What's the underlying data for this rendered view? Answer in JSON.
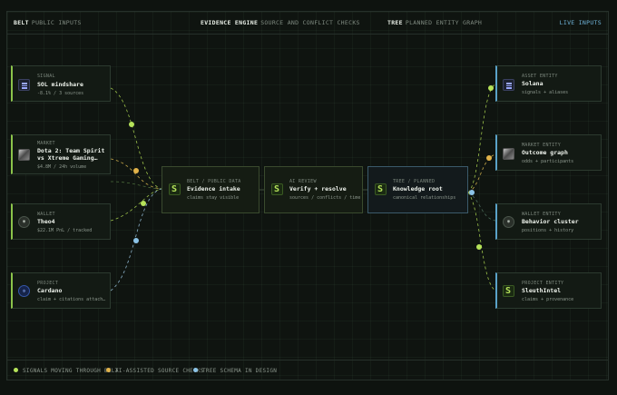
{
  "header": {
    "belt_label": "BELT",
    "belt_sub": "PUBLIC INPUTS",
    "engine_label": "EVIDENCE ENGINE",
    "engine_sub": "SOURCE AND CONFLICT CHECKS",
    "tree_label": "TREE",
    "tree_sub": "PLANNED ENTITY GRAPH",
    "live_label": "LIVE INPUTS"
  },
  "inputs": [
    {
      "kicker": "SIGNAL",
      "title": "SOL mindshare",
      "sub": "-8.1% / 3 sources",
      "icon": "solana-icon"
    },
    {
      "kicker": "MARKET",
      "title": "Dota 2: Team Spirit",
      "title2": "vs Xtreme Gaming…",
      "sub": "$4.8M / 24h volume",
      "icon": "market-image-icon"
    },
    {
      "kicker": "WALLET",
      "title": "Theo4",
      "sub": "$22.1M PnL / tracked",
      "icon": "wallet-avatar-icon"
    },
    {
      "kicker": "PROJECT",
      "title": "Cardano",
      "sub": "claim + citations attach…",
      "icon": "cardano-icon"
    }
  ],
  "stages": [
    {
      "kicker": "BELT / PUBLIC DATA",
      "title": "Evidence intake",
      "sub": "claims stay visible"
    },
    {
      "kicker": "AI REVIEW",
      "title": "Verify + resolve",
      "sub": "sources / conflicts / time"
    },
    {
      "kicker": "TREE / PLANNED",
      "title": "Knowledge root",
      "sub": "canonical relationships"
    }
  ],
  "entities": [
    {
      "kicker": "ASSET ENTITY",
      "title": "Solana",
      "sub": "signals + aliases",
      "icon": "solana-icon"
    },
    {
      "kicker": "MARKET ENTITY",
      "title": "Outcome graph",
      "sub": "odds + participants",
      "icon": "market-image-icon"
    },
    {
      "kicker": "WALLET ENTITY",
      "title": "Behavior cluster",
      "sub": "positions + history",
      "icon": "wallet-avatar-icon"
    },
    {
      "kicker": "PROJECT ENTITY",
      "title": "SleuthIntel",
      "sub": "claims + provenance",
      "icon": "s-logo-icon"
    }
  ],
  "legend": [
    {
      "label": "SIGNALS MOVING THROUGH BELT",
      "color": "#b6e35a"
    },
    {
      "label": "AI-ASSISTED SOURCE CHECKS",
      "color": "#e2b34a"
    },
    {
      "label": "TREE SCHEMA IN DESIGN",
      "color": "#8cc4e8"
    }
  ],
  "colors": {
    "accent_green": "#8bc34a",
    "accent_blue": "#5aa2c8",
    "live": "#6fb3d9"
  }
}
